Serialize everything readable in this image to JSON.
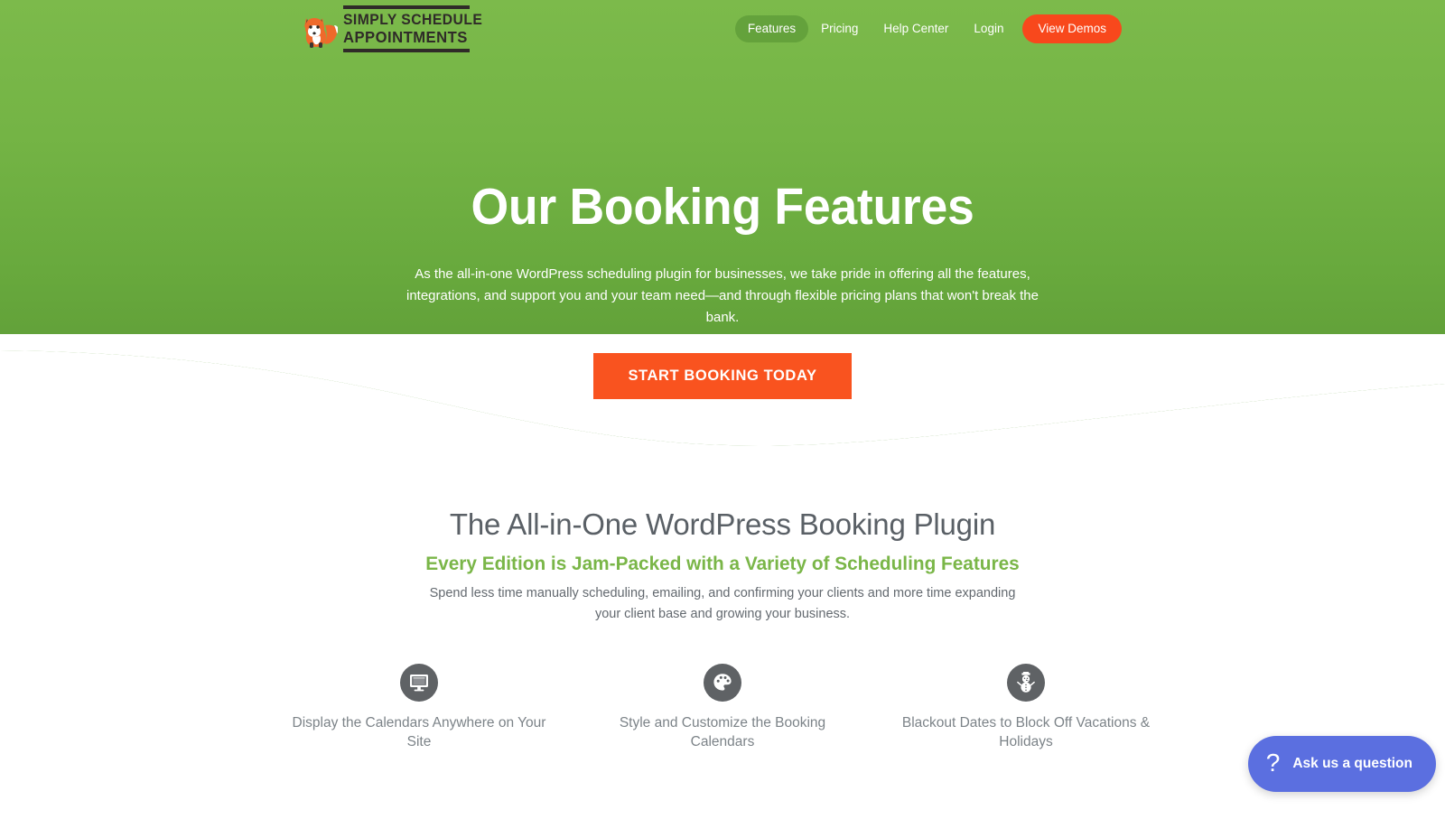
{
  "header": {
    "logo": {
      "icon": "fox-mascot-icon",
      "line1": "SIMPLY SCHEDULE",
      "line2": "APPOINTMENTS"
    },
    "nav": [
      {
        "label": "Features",
        "active": true
      },
      {
        "label": "Pricing",
        "active": false
      },
      {
        "label": "Help Center",
        "active": false
      },
      {
        "label": "Login",
        "active": false
      }
    ],
    "cta": {
      "label": "View Demos"
    }
  },
  "hero": {
    "title": "Our Booking Features",
    "subtitle": "As the all-in-one WordPress scheduling plugin for businesses, we take pride in offering all the features, integrations, and support you and your team need—and through flexible pricing plans that won't break the bank.",
    "cta_label": "START BOOKING TODAY"
  },
  "main": {
    "title": "The All-in-One WordPress Booking Plugin",
    "subtitle": "Every Edition is Jam-Packed with a Variety of Scheduling Features",
    "body": "Spend less time manually scheduling, emailing, and confirming your clients and more time expanding your client base and growing your business."
  },
  "features": [
    {
      "icon": "monitor-icon",
      "caption": "Display the Calendars Anywhere on Your Site"
    },
    {
      "icon": "palette-icon",
      "caption": "Style and Customize the Booking Calendars"
    },
    {
      "icon": "snowman-icon",
      "caption": "Blackout Dates to Block Off Vacations & Holidays"
    }
  ],
  "chat": {
    "icon": "question-mark-icon",
    "label": "Ask us a question"
  },
  "colors": {
    "green_top": "#7cba4b",
    "green_bottom": "#589433",
    "orange": "#f9531f",
    "accent_green_text": "#7ab648",
    "heading_gray": "#5a6066",
    "icon_circle_gray": "#5f6265",
    "chat_blue": "#5b6fe0"
  }
}
